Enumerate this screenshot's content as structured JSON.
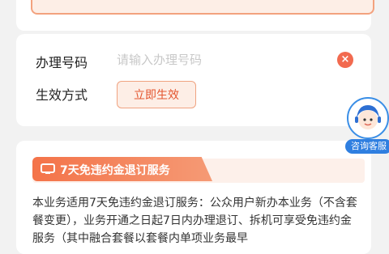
{
  "form": {
    "number_label": "办理号码",
    "number_placeholder": "请输入办理号码",
    "clear_symbol": "×",
    "effect_label": "生效方式",
    "effect_button": "立即生效"
  },
  "customer_service": {
    "label": "咨询客服"
  },
  "service_info": {
    "title": "7天免违约金退订服务",
    "body": "本业务适用7天免违约金退订服务：公众用户新办本业务（不含套餐变更），业务开通之日起7日内办理退订、拆机可享受免违约金服务（其中融合套餐以套餐内单项业务最早"
  },
  "colors": {
    "accent": "#f26a4f",
    "button_bg": "#fdeee6",
    "cs_blue": "#2f7fe0"
  }
}
